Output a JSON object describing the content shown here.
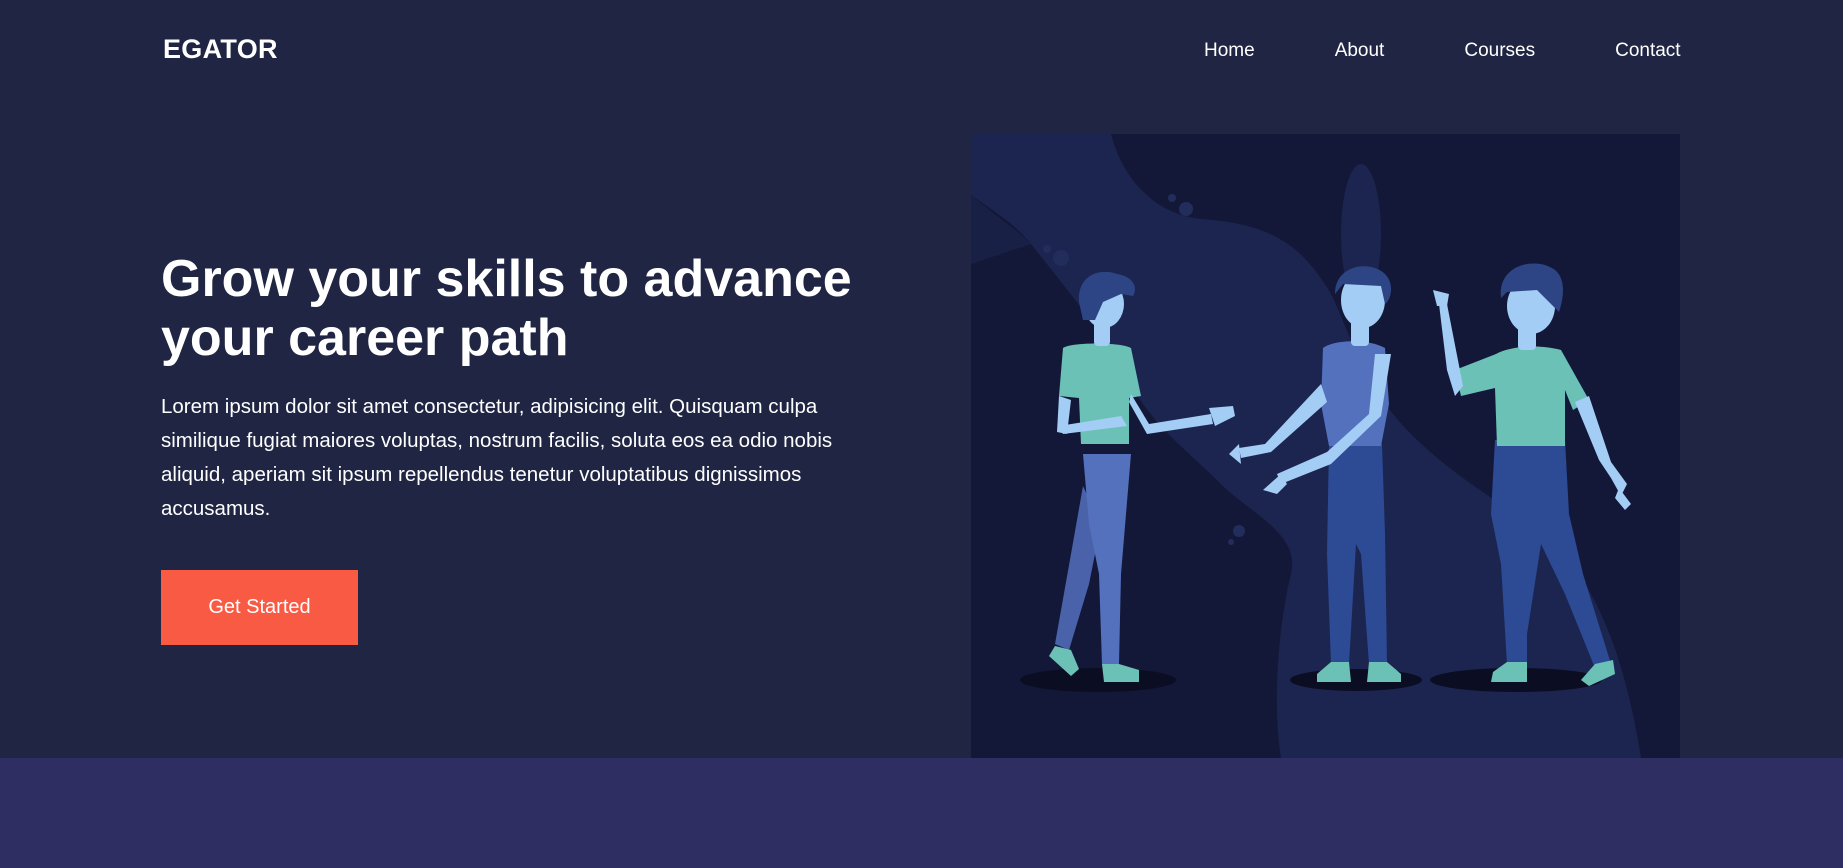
{
  "header": {
    "brand": "EGATOR",
    "nav": [
      {
        "label": "Home"
      },
      {
        "label": "About"
      },
      {
        "label": "Courses"
      },
      {
        "label": "Contact"
      }
    ]
  },
  "hero": {
    "title": "Grow your skills to advance your career path",
    "description": "Lorem ipsum dolor sit amet consectetur, adipisicing elit. Quisquam culpa similique fugiat maiores voluptas, nostrum facilis, soluta eos ea odio nobis aliquid, aperiam sit ipsum repellendus tenetur voluptatibus dignissimos accusamus.",
    "cta_label": "Get Started"
  },
  "colors": {
    "background": "#1f2543",
    "accent": "#f85a44",
    "band": "#2f2e63",
    "teal": "#6bc1b6",
    "skin": "#a3cdf5"
  },
  "illustration": {
    "icon": "people-greeting-illustration"
  }
}
